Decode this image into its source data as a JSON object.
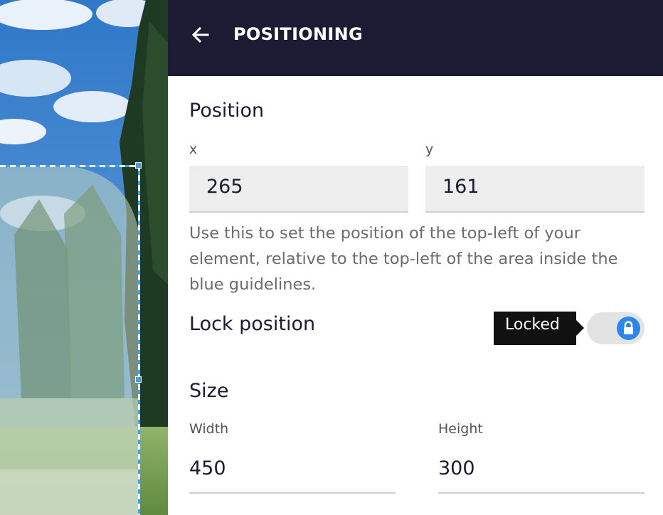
{
  "header": {
    "title": "POSITIONING"
  },
  "position": {
    "title": "Position",
    "x_label": "x",
    "x_value": "265",
    "y_label": "y",
    "y_value": "161",
    "help": "Use this to set the position of the top-left of your element, relative to the top-left of the area inside the blue guidelines."
  },
  "lock": {
    "label": "Lock position",
    "tooltip": "Locked",
    "state": "locked"
  },
  "size": {
    "title": "Size",
    "width_label": "Width",
    "width_value": "450",
    "height_label": "Height",
    "height_value": "300"
  },
  "colors": {
    "header_bg": "#1b1c33",
    "accent": "#2e86e8",
    "guideline": "#3aa2e6"
  },
  "icons": [
    "arrow-left-icon",
    "lock-icon"
  ]
}
